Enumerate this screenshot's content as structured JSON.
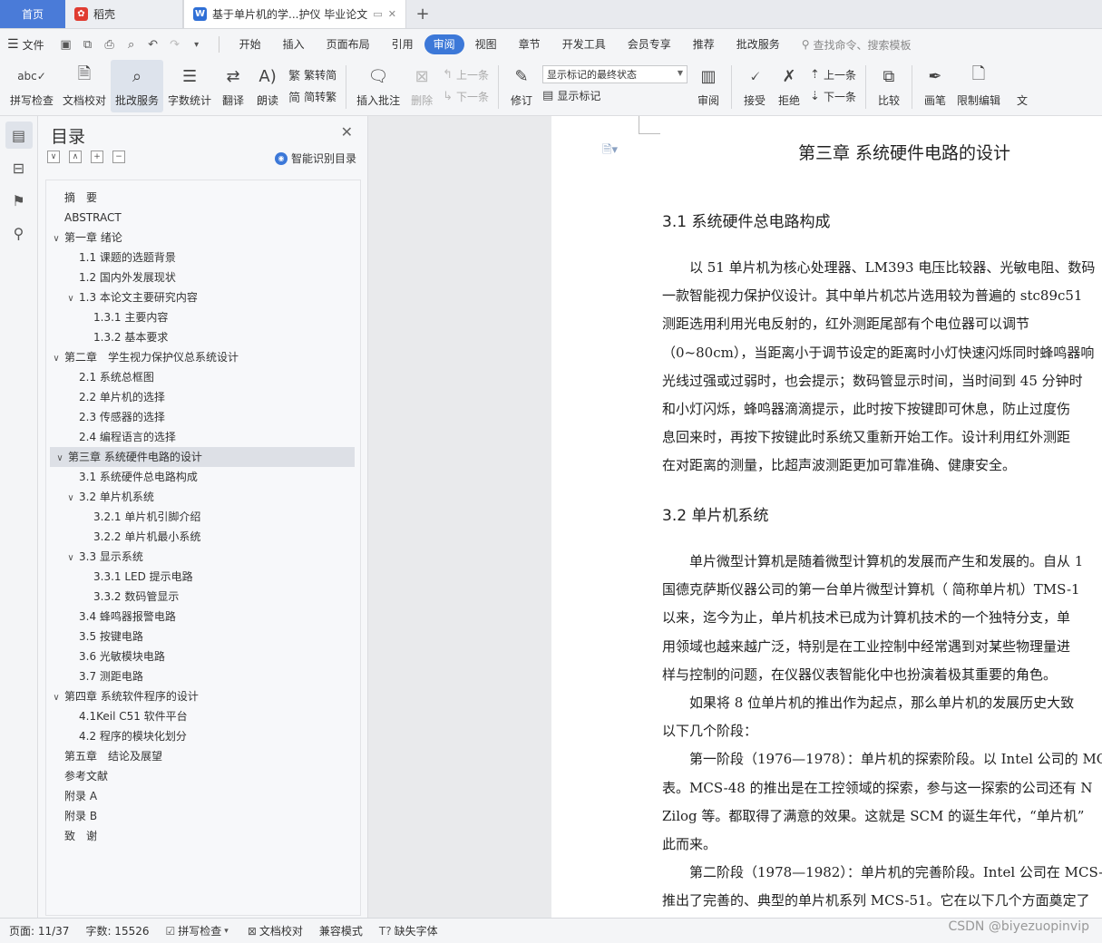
{
  "tabs": {
    "home": "首页",
    "daoke": "稻壳",
    "doc": "基于单片机的学...护仪 毕业论文",
    "add": "+"
  },
  "menu": {
    "file": "文件",
    "items": [
      "开始",
      "插入",
      "页面布局",
      "引用",
      "审阅",
      "视图",
      "章节",
      "开发工具",
      "会员专享",
      "推荐",
      "批改服务"
    ],
    "search": "查找命令、搜索模板"
  },
  "ribbon": {
    "spell": "拼写检查",
    "doc_check": "文档校对",
    "review_service": "批改服务",
    "word_count": "字数统计",
    "translate": "翻译",
    "read_aloud": "朗读",
    "trad": "繁转简",
    "simp": "简转繁",
    "insert_comment": "插入批注",
    "delete": "删除",
    "prev_comment": "上一条",
    "next_comment": "下一条",
    "track": "修订",
    "markup_select": "显示标记的最终状态",
    "show_markup": "显示标记",
    "review": "审阅",
    "accept": "接受",
    "reject": "拒绝",
    "prev_change": "上一条",
    "next_change": "下一条",
    "compare": "比较",
    "pen": "画笔",
    "restrict": "限制编辑",
    "doc": "文"
  },
  "toc": {
    "title": "目录",
    "smart": "智能识别目录",
    "items": [
      {
        "label": "摘　要"
      },
      {
        "label": "ABSTRACT"
      },
      {
        "label": "第一章  绪论"
      },
      {
        "label": "1.1 课题的选题背景"
      },
      {
        "label": "1.2 国内外发展现状"
      },
      {
        "label": "1.3 本论文主要研究内容"
      },
      {
        "label": "1.3.1 主要内容"
      },
      {
        "label": "1.3.2 基本要求"
      },
      {
        "label": "第二章　学生视力保护仪总系统设计"
      },
      {
        "label": "2.1 系统总框图"
      },
      {
        "label": "2.2 单片机的选择"
      },
      {
        "label": "2.3 传感器的选择"
      },
      {
        "label": "2.4 编程语言的选择"
      },
      {
        "label": "第三章  系统硬件电路的设计"
      },
      {
        "label": "3.1 系统硬件总电路构成"
      },
      {
        "label": "3.2 单片机系统"
      },
      {
        "label": "3.2.1 单片机引脚介绍"
      },
      {
        "label": "3.2.2 单片机最小系统"
      },
      {
        "label": "3.3 显示系统"
      },
      {
        "label": "3.3.1 LED 提示电路"
      },
      {
        "label": "3.3.2 数码管显示"
      },
      {
        "label": "3.4 蜂鸣器报警电路"
      },
      {
        "label": "3.5 按键电路"
      },
      {
        "label": "3.6 光敏模块电路"
      },
      {
        "label": "3.7 测距电路"
      },
      {
        "label": "第四章  系统软件程序的设计"
      },
      {
        "label": "4.1Keil C51 软件平台"
      },
      {
        "label": "4.2 程序的模块化划分"
      },
      {
        "label": "第五章　结论及展望"
      },
      {
        "label": "参考文献"
      },
      {
        "label": "附录 A"
      },
      {
        "label": "附录 B"
      },
      {
        "label": "致　谢"
      }
    ]
  },
  "doc": {
    "chapter": "第三章  系统硬件电路的设计",
    "h31": "3.1 系统硬件总电路构成",
    "p1": [
      "　　以 51 单片机为核心处理器、LM393 电压比较器、光敏电阻、数码",
      "一款智能视力保护仪设计。其中单片机芯片选用较为普遍的 stc89c51",
      "测距选用利用光电反射的，红外测距尾部有个电位器可以调节",
      "（0~80cm），当距离小于调节设定的距离时小灯快速闪烁同时蜂鸣器响",
      "光线过强或过弱时，也会提示；数码管显示时间，当时间到 45 分钟时",
      "和小灯闪烁，蜂鸣器滴滴提示，此时按下按键即可休息，防止过度伤",
      "息回来时，再按下按键此时系统又重新开始工作。设计利用红外测距",
      "在对距离的测量，比超声波测距更加可靠准确、健康安全。"
    ],
    "h32": "3.2 单片机系统",
    "p2": [
      "　　单片微型计算机是随着微型计算机的发展而产生和发展的。自从 1",
      "国德克萨斯仪器公司的第一台单片微型计算机（ 简称单片机）TMS-1",
      "以来，迄今为止，单片机技术已成为计算机技术的一个独特分支，单",
      "用领域也越来越广泛，特别是在工业控制中经常遇到对某些物理量进",
      "样与控制的问题，在仪器仪表智能化中也扮演着极其重要的角色。",
      "　　如果将 8 位单片机的推出作为起点，那么单片机的发展历史大致",
      "以下几个阶段：",
      "　　第一阶段（1976—1978）：单片机的探索阶段。以 Intel 公司的 MC",
      "表。MCS-48 的推出是在工控领域的探索，参与这一探索的公司还有 N",
      "Zilog 等。都取得了满意的效果。这就是 SCM 的诞生年代，“单片机”",
      "此而来。",
      "　　第二阶段（1978—1982）：单片机的完善阶段。Intel 公司在 MCS-",
      "推出了完善的、典型的单片机系列 MCS-51。它在以下几个方面奠定了"
    ]
  },
  "status": {
    "page": "页面: 11/37",
    "words": "字数: 15526",
    "spell": "拼写检查",
    "doc_check": "文档校对",
    "compat": "兼容模式",
    "missing_font": "缺失字体"
  },
  "watermark": "CSDN @biyezuopinvip",
  "colors": {
    "accent": "#3c78d8",
    "home_tab": "#4a7bd8",
    "daoke_icon": "#e03c31",
    "wps_icon": "#2f6fd6"
  }
}
